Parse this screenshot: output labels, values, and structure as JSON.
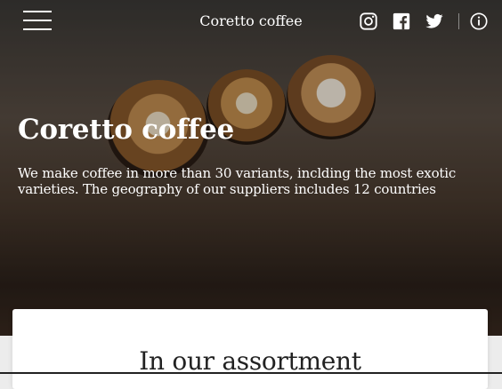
{
  "header": {
    "brand": "Coretto coffee",
    "icons": [
      "menu-icon",
      "instagram-icon",
      "facebook-icon",
      "twitter-icon",
      "info-icon"
    ]
  },
  "hero": {
    "title": "Coretto coffee",
    "description": "We make coffee in more than 30 variants, inclding the most exotic varieties. The geography of our suppliers includes 12 countries"
  },
  "section": {
    "title": "In our assortment"
  },
  "colors": {
    "text_on_hero": "#ffffff",
    "card_bg": "#ffffff",
    "page_bg": "#ececec"
  }
}
